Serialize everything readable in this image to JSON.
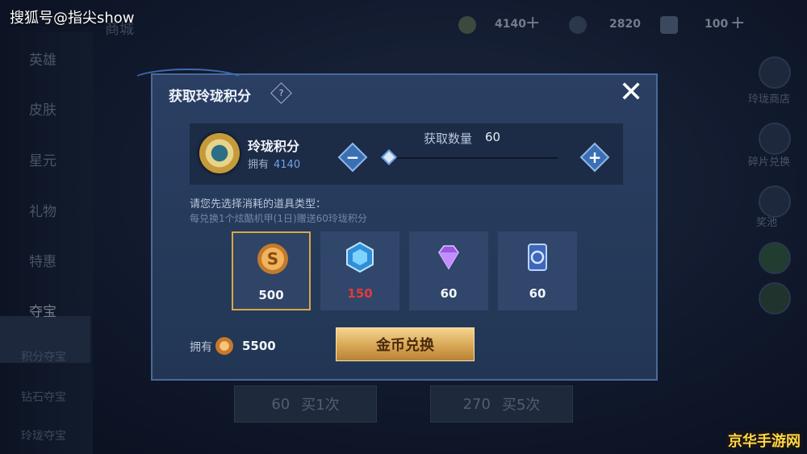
{
  "watermark": {
    "top": "搜狐号@指尖show",
    "bottom": "京华手游网"
  },
  "background": {
    "title": "商城",
    "left_nav": [
      "英雄",
      "皮肤",
      "星元",
      "礼物",
      "特惠",
      "夺宝",
      "积分夺宝",
      "钻石夺宝",
      "玲珑夺宝"
    ],
    "top_currencies": [
      {
        "icon": "point-coin-icon",
        "value": "4140"
      },
      {
        "icon": "diamond-currency-icon",
        "value": "2820"
      },
      {
        "icon": "card-currency-icon",
        "value": "100"
      }
    ],
    "right_nav": [
      "玲珑商店",
      "碎片兑换",
      "奖池"
    ],
    "buy_buttons": [
      {
        "amount": "60",
        "label": "买1次"
      },
      {
        "amount": "270",
        "label": "买5次"
      }
    ]
  },
  "dialog": {
    "title": "获取玲珑积分",
    "help": "?",
    "close": "✕",
    "points": {
      "name": "玲珑积分",
      "own_label": "拥有",
      "own_value": "4140"
    },
    "quantity": {
      "label": "获取数量",
      "value": "60",
      "slider_fraction": 0.0,
      "minus": "−",
      "plus": "+"
    },
    "hint_select": "请您先选择消耗的道具类型：",
    "hint_bonus": "每兑换1个炫酷机甲(1日)赠送60玲珑积分",
    "options": [
      {
        "icon": "gold-coin-icon",
        "value": "500",
        "selected": true,
        "insufficient": false
      },
      {
        "icon": "blue-crystal-icon",
        "value": "150",
        "selected": false,
        "insufficient": true
      },
      {
        "icon": "purple-diamond-icon",
        "value": "60",
        "selected": false,
        "insufficient": false
      },
      {
        "icon": "voucher-card-icon",
        "value": "60",
        "selected": false,
        "insufficient": false
      }
    ],
    "own_label": "拥有",
    "own_coins": "5500",
    "exchange_button": "金币兑换"
  }
}
